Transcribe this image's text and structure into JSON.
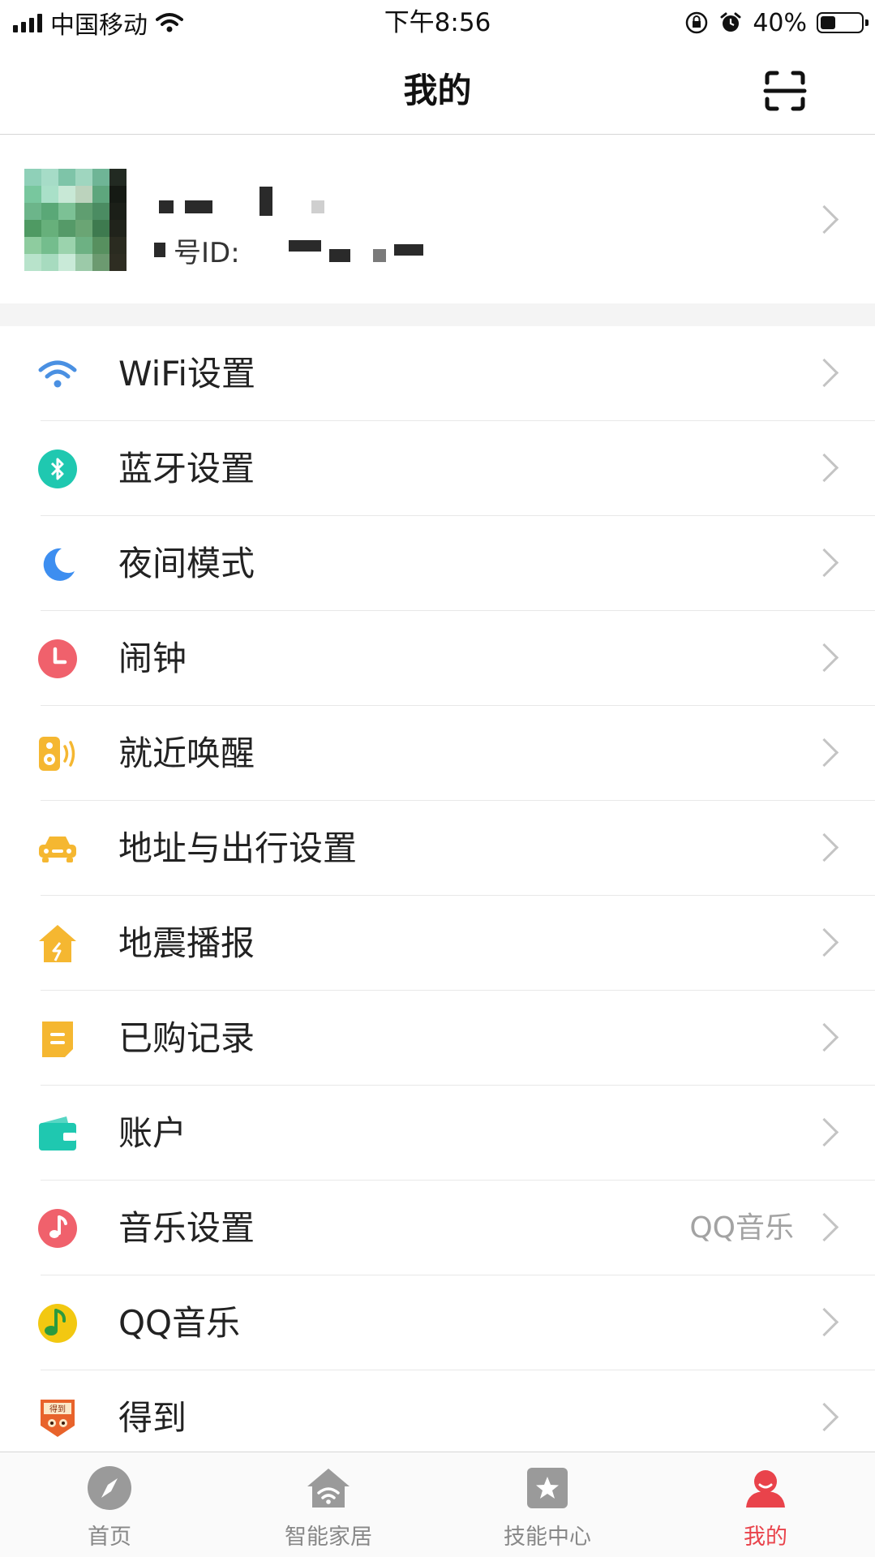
{
  "status_bar": {
    "carrier": "中国移动",
    "time": "下午8:56",
    "battery": "40%",
    "battery_level": 0.4
  },
  "header": {
    "title": "我的"
  },
  "profile": {
    "id_label": "号ID:"
  },
  "menu": [
    {
      "label": "WiFi设置",
      "icon": "wifi-icon",
      "color": "#4a90e2"
    },
    {
      "label": "蓝牙设置",
      "icon": "bluetooth-icon",
      "color": "#1fc8b0"
    },
    {
      "label": "夜间模式",
      "icon": "moon-icon",
      "color": "#3d8ef0"
    },
    {
      "label": "闹钟",
      "icon": "alarm-clock-icon",
      "color": "#f0616c"
    },
    {
      "label": "就近唤醒",
      "icon": "speaker-wake-icon",
      "color": "#f5b731"
    },
    {
      "label": "地址与出行设置",
      "icon": "car-icon",
      "color": "#f5b731"
    },
    {
      "label": "地震播报",
      "icon": "earthquake-house-icon",
      "color": "#f5b731"
    },
    {
      "label": "已购记录",
      "icon": "purchase-record-icon",
      "color": "#f5b731"
    },
    {
      "label": "账户",
      "icon": "wallet-icon",
      "color": "#1fc8b0"
    },
    {
      "label": "音乐设置",
      "icon": "music-note-icon",
      "color": "#f0616c",
      "value": "QQ音乐"
    },
    {
      "label": "QQ音乐",
      "icon": "qq-music-icon",
      "color": "#f2c811"
    },
    {
      "label": "得到",
      "icon": "dedao-app-icon",
      "color": "#e8632b"
    }
  ],
  "tabs": [
    {
      "label": "首页",
      "icon": "compass-icon"
    },
    {
      "label": "智能家居",
      "icon": "smart-home-icon"
    },
    {
      "label": "技能中心",
      "icon": "skill-star-icon"
    },
    {
      "label": "我的",
      "icon": "user-profile-icon",
      "active": true
    }
  ],
  "colors": {
    "accent": "#e9434b",
    "tab_inactive": "#888888",
    "chevron": "#c4c4c4"
  }
}
